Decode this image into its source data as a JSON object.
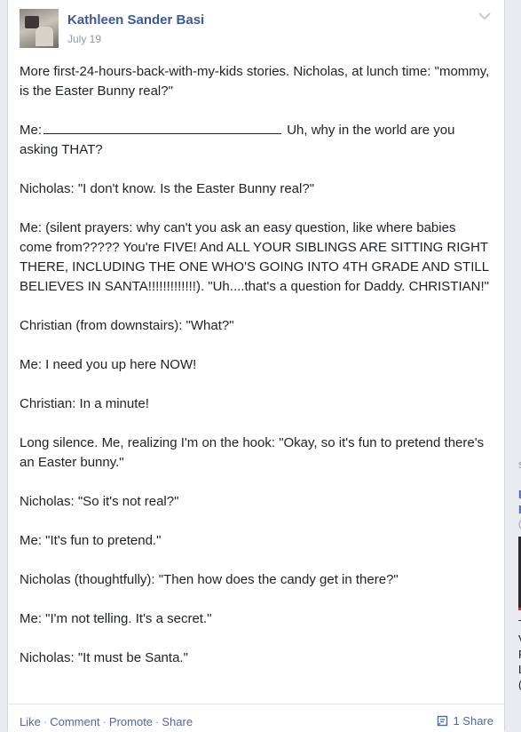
{
  "post": {
    "author": "Kathleen Sander Basi",
    "date": "July 19",
    "paragraphs": [
      "More first-24-hours-back-with-my-kids stories. Nicholas, at lunch time: \"mommy, is the Easter Bunny real?\"",
      "Nicholas: \"I don't know. Is the Easter Bunny real?\"",
      "Me: (silent prayers: why can't you ask an easy question, like where babies come from????? You're FIVE! And ALL YOUR SIBLINGS ARE SITTING RIGHT THERE, INCLUDING THE ONE WHO'S GOING INTO 4TH GRADE AND STILL BELIEVES IN SANTA!!!!!!!!!!!!!). \"Uh....that's a question for Daddy. CHRISTIAN!\"",
      "Christian (from downstairs): \"What?\"",
      "Me: I need you up here NOW!",
      "Christian: In a minute!",
      "Long silence. Me, realizing I'm on the hook: \"Okay, so it's fun to pretend there's an Easter bunny.\"",
      "Nicholas: \"So it's not real?\"",
      "Me: \"It's fun to pretend.\"",
      "Nicholas (thoughtfully): \"Then how does the candy get in there?\"",
      "Me: \"I'm not telling. It's a secret.\"",
      "Nicholas: \"It must be Santa.\""
    ],
    "blank_line": {
      "prefix": "Me:",
      "suffix": "Uh, why in the world are you asking THAT?"
    }
  },
  "footer": {
    "like": "Like",
    "comment": "Comment",
    "promote": "Promote",
    "share": "Share",
    "separator": "·",
    "share_count": "1 Share"
  },
  "right_rail": {
    "letters": [
      "s",
      "F",
      "F",
      "(",
      "T",
      "V",
      "F",
      "L",
      "("
    ]
  },
  "colors": {
    "link": "#3b5998",
    "action_link": "#4b6aa7",
    "meta_gray": "#9197a3",
    "text": "#1d2129"
  },
  "icons": [
    "chevron-down-icon",
    "share-icon"
  ]
}
